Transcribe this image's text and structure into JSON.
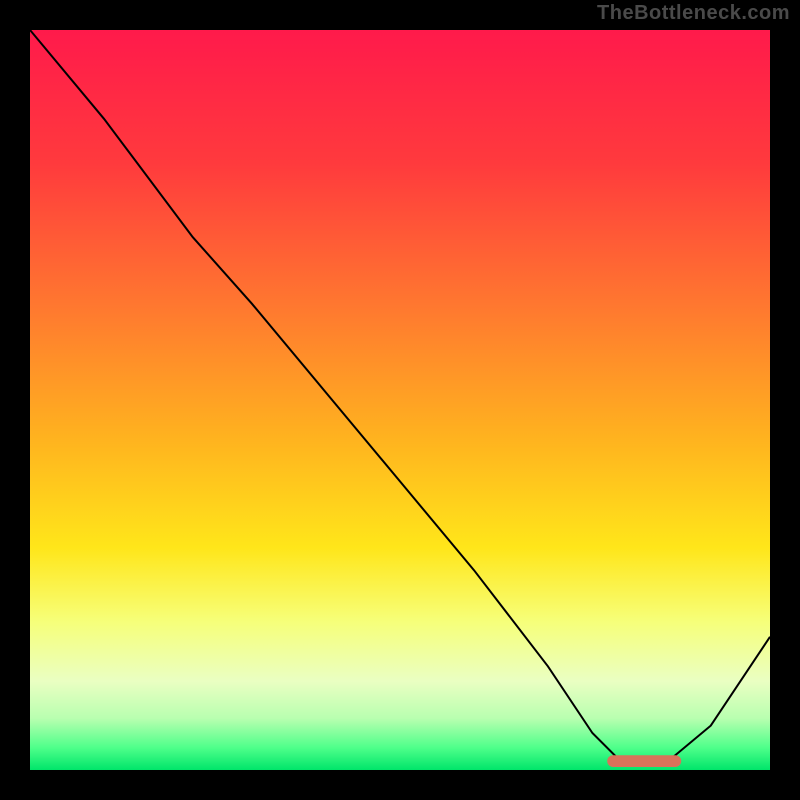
{
  "watermark": "TheBottleneck.com",
  "chart_data": {
    "type": "line",
    "title": "",
    "xlabel": "",
    "ylabel": "",
    "xlim": [
      0,
      100
    ],
    "ylim": [
      0,
      100
    ],
    "grid": false,
    "legend": false,
    "background": {
      "kind": "vertical-gradient",
      "stops": [
        {
          "pct": 0,
          "color": "#ff1a4b"
        },
        {
          "pct": 18,
          "color": "#ff3a3d"
        },
        {
          "pct": 38,
          "color": "#ff7a2f"
        },
        {
          "pct": 55,
          "color": "#ffb21f"
        },
        {
          "pct": 70,
          "color": "#ffe61a"
        },
        {
          "pct": 80,
          "color": "#f6ff7a"
        },
        {
          "pct": 88,
          "color": "#eaffc2"
        },
        {
          "pct": 93,
          "color": "#b9ffb0"
        },
        {
          "pct": 97,
          "color": "#4eff8a"
        },
        {
          "pct": 100,
          "color": "#00e56a"
        }
      ]
    },
    "series": [
      {
        "name": "bottleneck-curve",
        "color": "#000000",
        "x": [
          0,
          10,
          22,
          30,
          40,
          50,
          60,
          70,
          76,
          80,
          86,
          92,
          100
        ],
        "y": [
          100,
          88,
          72,
          63,
          51,
          39,
          27,
          14,
          5,
          1,
          1,
          6,
          18
        ]
      }
    ],
    "marker": {
      "name": "optimal-range",
      "color": "#d9725a",
      "x_start": 78,
      "x_end": 88,
      "y": 1.2,
      "thickness_pct": 1.6
    }
  }
}
